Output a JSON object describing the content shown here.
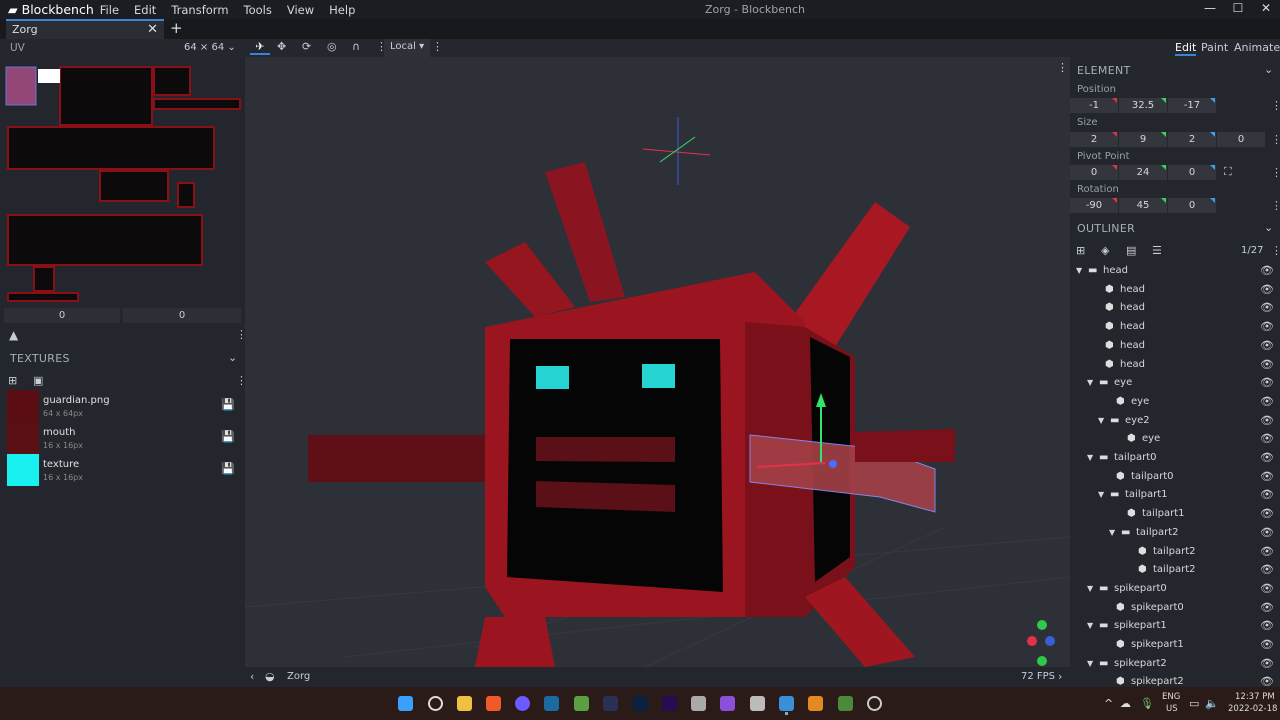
{
  "app": {
    "name": "Blockbench",
    "window_title": "Zorg - Blockbench",
    "menu": [
      "File",
      "Edit",
      "Transform",
      "Tools",
      "View",
      "Help"
    ]
  },
  "tabs": [
    {
      "label": "Zorg"
    }
  ],
  "uv": {
    "label": "UV",
    "size": "64 × 64",
    "offset": [
      "0",
      "0"
    ]
  },
  "toolbar": {
    "space": "Local"
  },
  "modes": [
    "Edit",
    "Paint",
    "Animate"
  ],
  "textures": {
    "title": "TEXTURES",
    "items": [
      {
        "name": "guardian.png",
        "size": "64 x 64px",
        "color": "#5a0d12"
      },
      {
        "name": "mouth",
        "size": "16 x 16px",
        "color": "#5a0f14"
      },
      {
        "name": "texture",
        "size": "16 x 16px",
        "color": "#19f0f0"
      }
    ]
  },
  "element": {
    "title": "ELEMENT",
    "position_label": "Position",
    "position": [
      "-1",
      "32.5",
      "-17"
    ],
    "size_label": "Size",
    "size": [
      "2",
      "9",
      "2",
      "0"
    ],
    "pivot_label": "Pivot Point",
    "pivot": [
      "0",
      "24",
      "0"
    ],
    "rotation_label": "Rotation",
    "rotation": [
      "-90",
      "45",
      "0"
    ]
  },
  "outliner": {
    "title": "OUTLINER",
    "count": "1/27",
    "items": [
      {
        "name": "head",
        "type": "group",
        "depth": 0
      },
      {
        "name": "head",
        "type": "cube",
        "depth": 1
      },
      {
        "name": "head",
        "type": "cube",
        "depth": 1
      },
      {
        "name": "head",
        "type": "cube",
        "depth": 1
      },
      {
        "name": "head",
        "type": "cube",
        "depth": 1
      },
      {
        "name": "head",
        "type": "cube",
        "depth": 1
      },
      {
        "name": "eye",
        "type": "group",
        "depth": 1
      },
      {
        "name": "eye",
        "type": "cube",
        "depth": 2
      },
      {
        "name": "eye2",
        "type": "group",
        "depth": 2
      },
      {
        "name": "eye",
        "type": "cube",
        "depth": 3
      },
      {
        "name": "tailpart0",
        "type": "group",
        "depth": 1
      },
      {
        "name": "tailpart0",
        "type": "cube",
        "depth": 2
      },
      {
        "name": "tailpart1",
        "type": "group",
        "depth": 2
      },
      {
        "name": "tailpart1",
        "type": "cube",
        "depth": 3
      },
      {
        "name": "tailpart2",
        "type": "group",
        "depth": 3
      },
      {
        "name": "tailpart2",
        "type": "cube",
        "depth": 4
      },
      {
        "name": "tailpart2",
        "type": "cube",
        "depth": 4
      },
      {
        "name": "spikepart0",
        "type": "group",
        "depth": 1
      },
      {
        "name": "spikepart0",
        "type": "cube",
        "depth": 2
      },
      {
        "name": "spikepart1",
        "type": "group",
        "depth": 1
      },
      {
        "name": "spikepart1",
        "type": "cube",
        "depth": 2
      },
      {
        "name": "spikepart2",
        "type": "group",
        "depth": 1
      },
      {
        "name": "spikepart2",
        "type": "cube",
        "depth": 2
      }
    ]
  },
  "status": {
    "model": "Zorg",
    "fps": "72 FPS"
  },
  "taskbar": {
    "lang": "ENG",
    "region": "US",
    "time": "12:37 PM",
    "date": "2022-02-18"
  }
}
